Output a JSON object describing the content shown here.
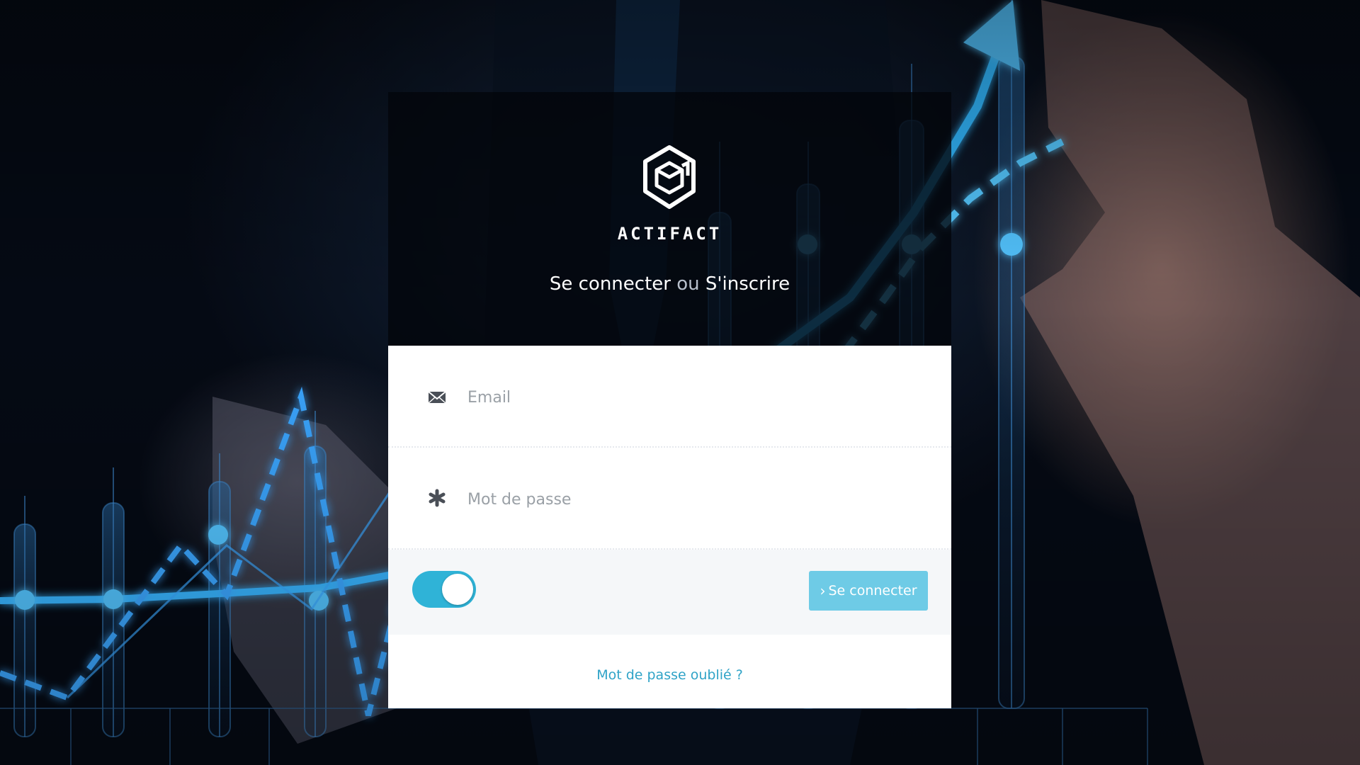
{
  "brand": {
    "logo_icon": "actifact-hexagon-logo",
    "name": "ACTIFACT"
  },
  "header": {
    "login_text": "Se connecter",
    "separator": "ou",
    "register_text": "S'inscrire"
  },
  "form": {
    "email_placeholder": "Email",
    "email_value": "",
    "email_icon": "envelope-icon",
    "password_placeholder": "Mot de passe",
    "password_value": "",
    "password_icon": "asterisk-icon",
    "remember_toggle_on": true,
    "submit_chevron": "›",
    "submit_label": "Se connecter",
    "forgot_password": "Mot de passe oublié ?"
  },
  "colors": {
    "accent": "#2fb3d7",
    "button": "#6ecbe6",
    "link": "#2fa3c7",
    "header_bg": "#02050a"
  }
}
